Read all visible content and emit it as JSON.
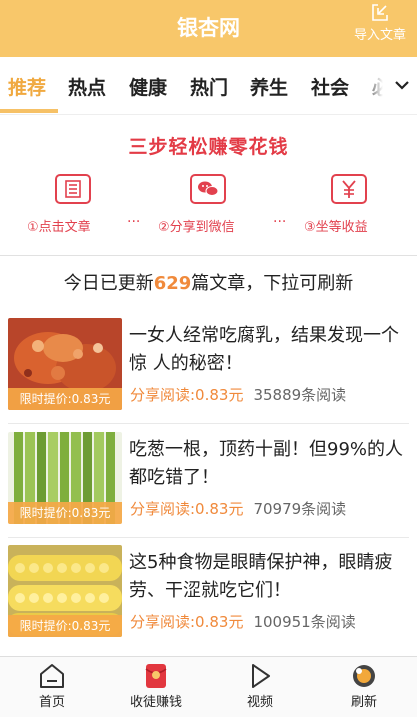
{
  "header": {
    "title": "银杏网",
    "import_label": "导入文章"
  },
  "tabs": [
    {
      "label": "推荐",
      "active": true
    },
    {
      "label": "热点"
    },
    {
      "label": "健康"
    },
    {
      "label": "热门"
    },
    {
      "label": "养生"
    },
    {
      "label": "社会"
    },
    {
      "label": "必"
    }
  ],
  "promo": {
    "title": "三步轻松赚零花钱",
    "steps": [
      {
        "label": "①点击文章",
        "icon": "article-icon"
      },
      {
        "label": "②分享到微信",
        "icon": "wechat-icon"
      },
      {
        "label": "③坐等收益",
        "icon": "yen-icon"
      }
    ],
    "dots": "···"
  },
  "update": {
    "prefix": "今日已更新",
    "count": "629",
    "suffix": "篇文章，下拉可刷新"
  },
  "articles": [
    {
      "title": "一女人经常吃腐乳，结果发现一个惊 人的秘密！",
      "badge": "限时提价:0.83元",
      "share": "分享阅读:0.83元",
      "reads": "35889条阅读",
      "image": "fermented-tofu"
    },
    {
      "title": "吃葱一根，顶药十副！但99%的人都吃错了！",
      "badge": "限时提价:0.83元",
      "share": "分享阅读:0.83元",
      "reads": "70979条阅读",
      "image": "green-onions"
    },
    {
      "title": "这5种食物是眼睛保护神，眼睛疲劳、干涩就吃它们！",
      "badge": "限时提价:0.83元",
      "share": "分享阅读:0.83元",
      "reads": "100951条阅读",
      "image": "corn"
    }
  ],
  "bottom_nav": [
    {
      "label": "首页",
      "icon": "home-icon"
    },
    {
      "label": "收徒赚钱",
      "icon": "red-envelope-icon"
    },
    {
      "label": "视频",
      "icon": "play-icon"
    },
    {
      "label": "刷新",
      "icon": "refresh-icon"
    }
  ],
  "colors": {
    "brand": "#f8c76a",
    "accent": "#f0a940",
    "promo_red": "#e2414e",
    "price_orange": "#f08a3c"
  }
}
